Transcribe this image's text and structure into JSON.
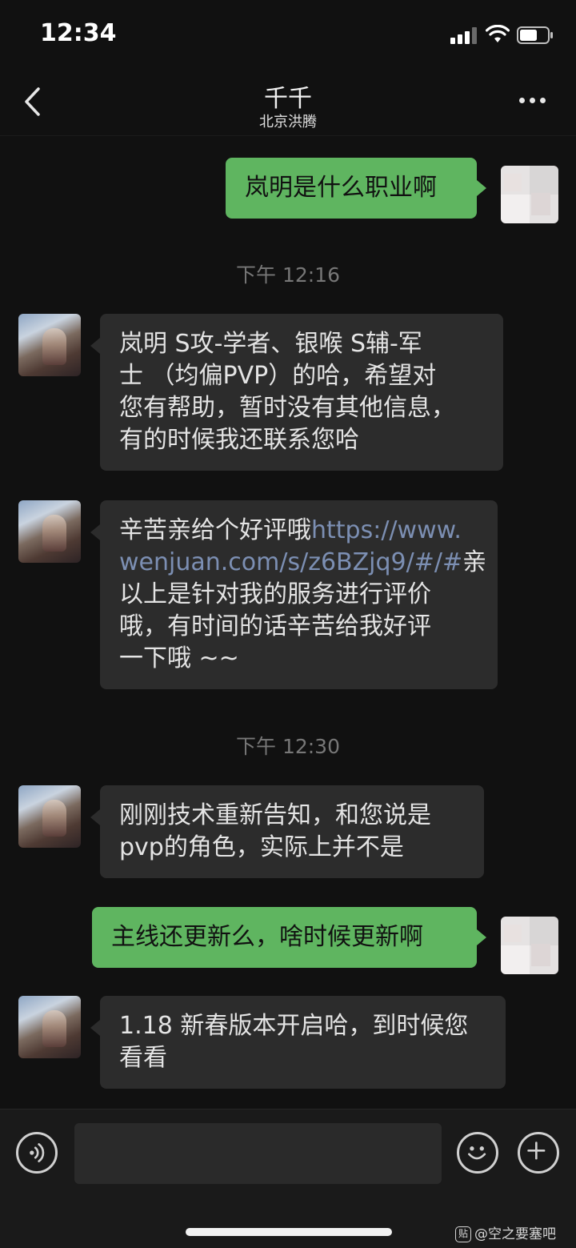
{
  "status_bar": {
    "time": "12:34",
    "signal_icon": "cellular-signal-icon",
    "wifi_icon": "wifi-icon",
    "battery_icon": "battery-icon"
  },
  "header": {
    "title": "千千",
    "subtitle": "北京洪腾",
    "back_icon": "chevron-left-icon",
    "more_icon": "more-dots-icon"
  },
  "messages": [
    {
      "from": "self",
      "text": "岚明是什么职业啊"
    },
    {
      "type": "timestamp",
      "text": "下午 12:16"
    },
    {
      "from": "other",
      "lines": [
        "岚明 S攻-学者、银喉 S辅-军",
        "士 （均偏PVP）的哈，希望对",
        "您有帮助，暂时没有其他信息，",
        "有的时候我还联系您哈"
      ]
    },
    {
      "from": "other",
      "line1_text": "辛苦亲给个好评哦",
      "line1_link": "https://www.",
      "line2_link": "wenjuan.com/s/z6BZjq9/#/#",
      "line2_text": "亲",
      "lines_rest": [
        "以上是针对我的服务进行评价",
        "哦，有时间的话辛苦给我好评",
        "一下哦 ~~"
      ]
    },
    {
      "type": "timestamp",
      "text": "下午 12:30"
    },
    {
      "from": "other",
      "lines": [
        "刚刚技术重新告知，和您说是",
        "pvp的角色，实际上并不是"
      ]
    },
    {
      "from": "self",
      "text": "主线还更新么，啥时候更新啊"
    },
    {
      "from": "other",
      "lines": [
        "1.18 新春版本开启哈，到时候您",
        "看看"
      ]
    }
  ],
  "input_bar": {
    "voice_icon": "voice-icon",
    "input_value": "",
    "emoji_icon": "emoji-icon",
    "plus_icon": "plus-icon"
  },
  "watermark": {
    "badge": "贴",
    "text": "@空之要塞吧"
  },
  "colors": {
    "background": "#111111",
    "incoming_bubble": "#2c2c2c",
    "outgoing_bubble": "#5fb560",
    "link": "#7c8fb3",
    "timestamp": "#777777"
  }
}
